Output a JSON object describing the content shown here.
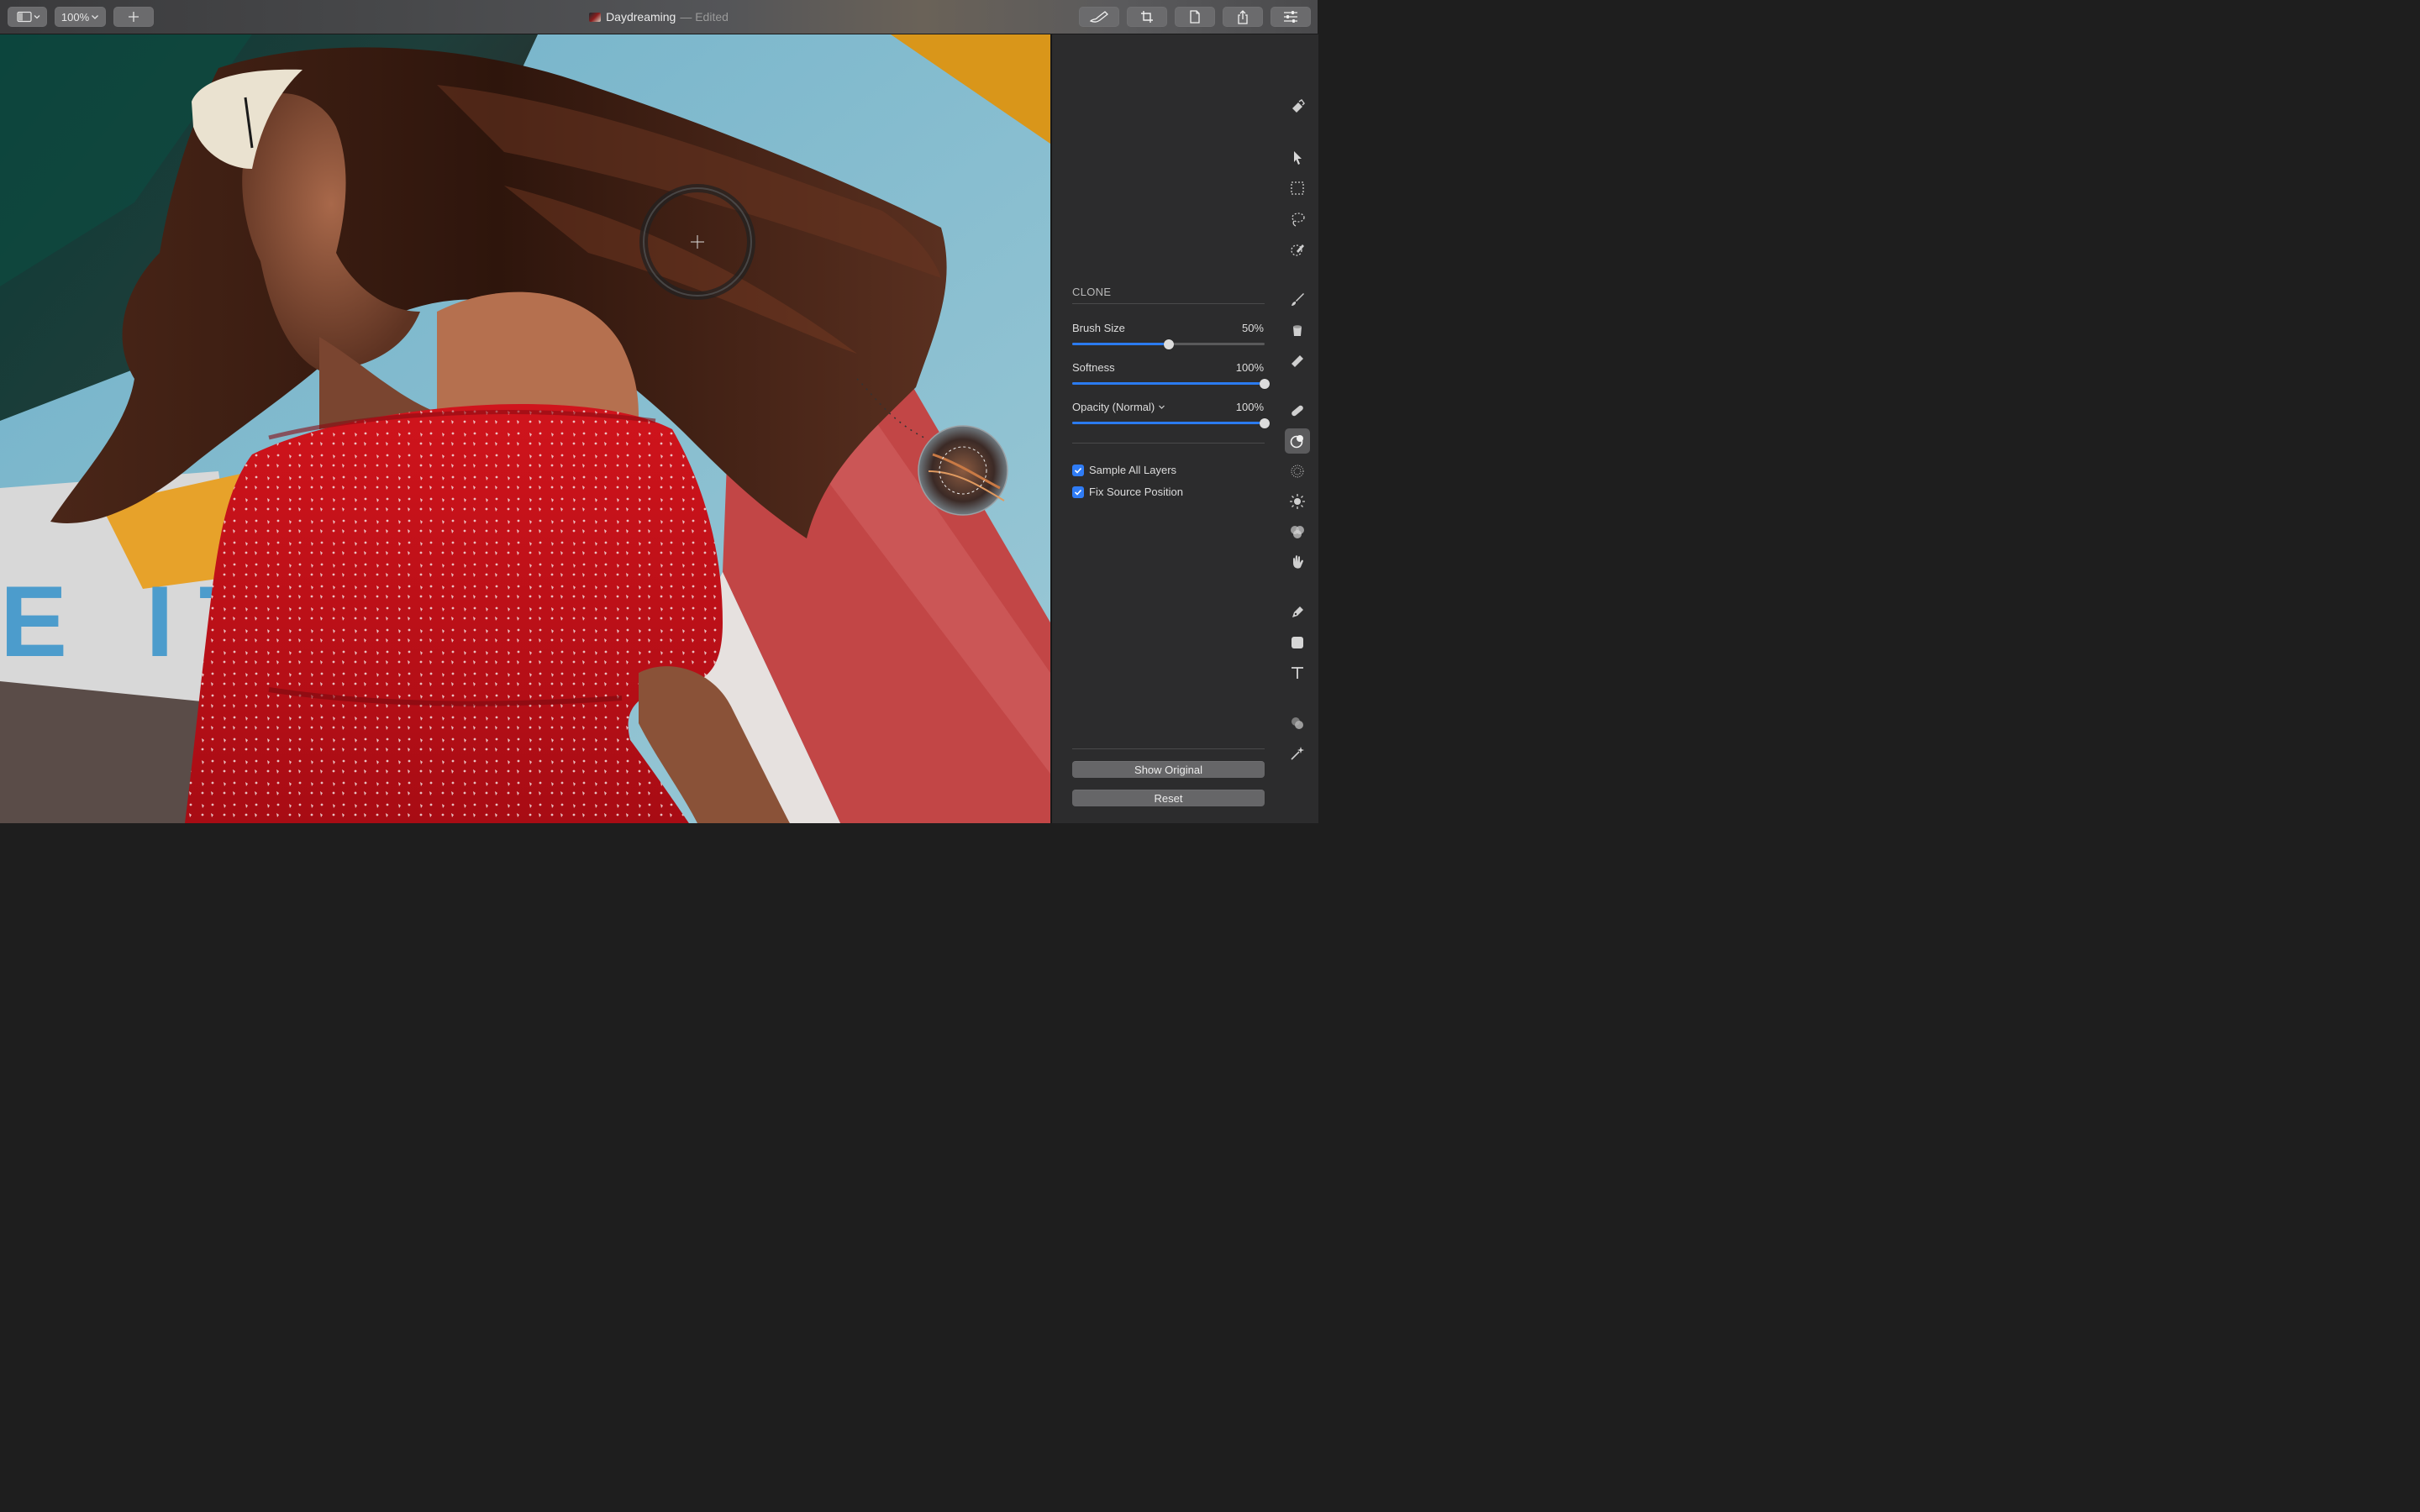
{
  "window": {
    "title": "Daydreaming",
    "status": "— Edited"
  },
  "toolbar": {
    "zoom_label": "100%",
    "add_label": "+",
    "left_buttons": [
      "sidebar-toggle-icon",
      "zoom-menu",
      "plus-icon"
    ],
    "right_buttons": [
      "retouch-brush-icon",
      "crop-icon",
      "document-icon",
      "share-icon",
      "adjustments-icon"
    ]
  },
  "panel": {
    "section_title": "CLONE",
    "sliders": [
      {
        "label": "Brush Size",
        "value_text": "50%",
        "value": 0.5
      },
      {
        "label": "Softness",
        "value_text": "100%",
        "value": 1.0
      },
      {
        "label": "Opacity (Normal)",
        "value_text": "100%",
        "value": 1.0,
        "has_menu": true
      }
    ],
    "checkboxes": [
      {
        "label": "Sample All Layers",
        "checked": true
      },
      {
        "label": "Fix Source Position",
        "checked": true
      }
    ],
    "buttons": {
      "show_original": "Show Original",
      "reset": "Reset"
    }
  },
  "tools": [
    "paint-bucket-style-icon",
    "arrow-select-icon",
    "rect-select-icon",
    "lasso-icon",
    "quick-select-icon",
    "paint-brush-icon",
    "fill-bucket-icon",
    "eraser-icon",
    "healing-bandage-icon",
    "clone-stamp-icon",
    "blur-icon",
    "dodge-sun-icon",
    "color-blend-icon",
    "smudge-hand-icon",
    "pen-icon",
    "shape-icon",
    "text-icon",
    "color-adjust-icon",
    "effects-icon"
  ],
  "active_tool": "clone-stamp-icon",
  "colors": {
    "accent": "#2b7bf0",
    "panel_bg": "#2c2c2d",
    "toolbar_button": "#6b6b6d"
  }
}
